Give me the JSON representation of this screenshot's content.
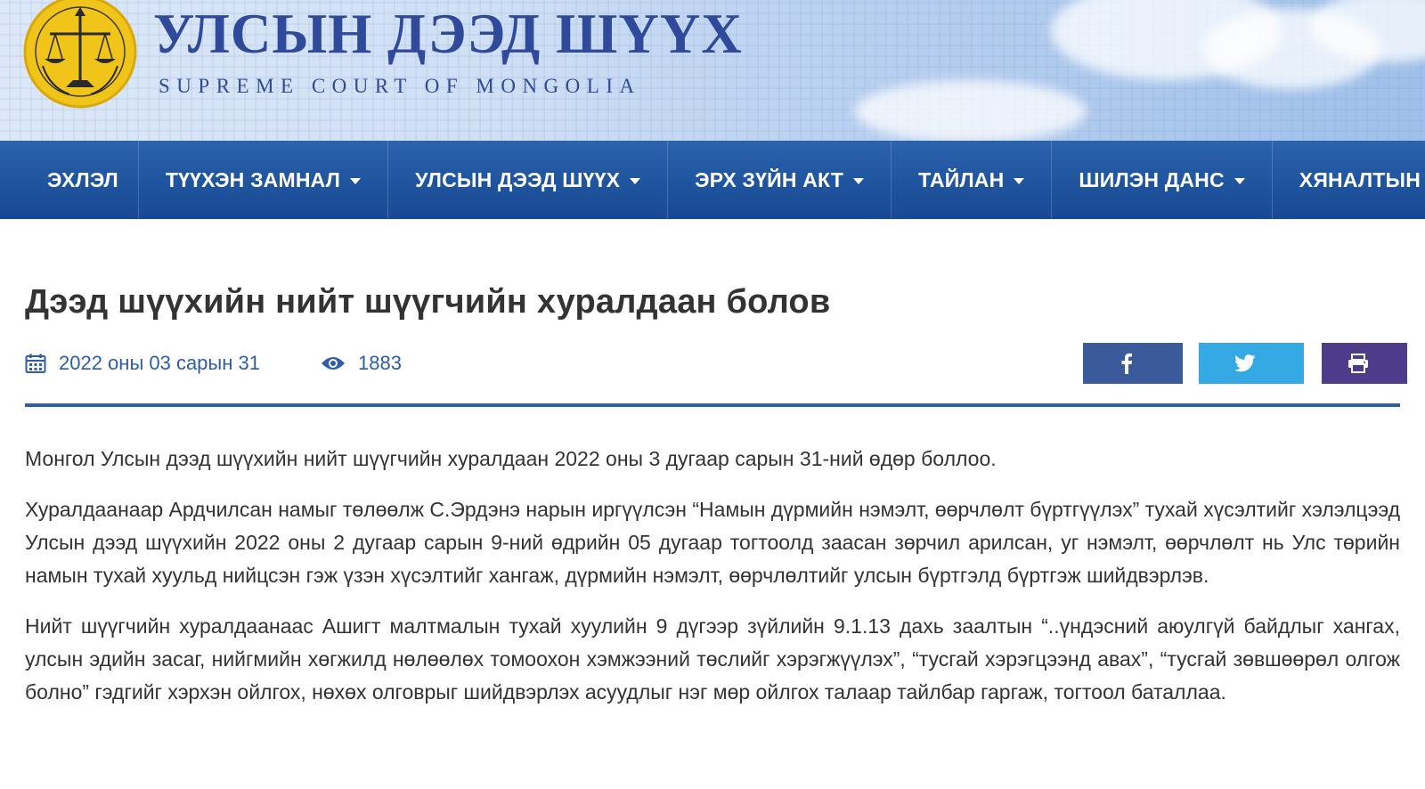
{
  "header": {
    "title": "УЛСЫН ДЭЭД ШҮҮХ",
    "subtitle": "SUPREME COURT OF MONGOLIA",
    "logo_icon": "scales-of-justice-emblem",
    "colors": {
      "title": "#2f4a9b",
      "emblem": "#f0c419"
    }
  },
  "nav": {
    "items": [
      {
        "label": "ЭХЛЭЛ",
        "dropdown": false
      },
      {
        "label": "ТҮҮХЭН ЗАМНАЛ",
        "dropdown": true
      },
      {
        "label": "УЛСЫН ДЭЭД ШҮҮХ",
        "dropdown": true
      },
      {
        "label": "ЭРХ ЗҮЙН АКТ",
        "dropdown": true
      },
      {
        "label": "ТАЙЛАН",
        "dropdown": true
      },
      {
        "label": "ШИЛЭН ДАНС",
        "dropdown": true
      },
      {
        "label": "ХЯНАЛТЫН ШАТНЫ ШҮ",
        "dropdown": false
      }
    ],
    "background": "#1f549e"
  },
  "article": {
    "title": "Дээд шүүхийн нийт шүүгчийн хуралдаан болов",
    "date": "2022 оны 03 сарын 31",
    "views": "1883",
    "meta_icons": [
      "calendar-icon",
      "eye-icon"
    ],
    "share_buttons": [
      {
        "name": "facebook",
        "icon": "facebook-icon",
        "color": "#3b5a9a"
      },
      {
        "name": "twitter",
        "icon": "twitter-icon",
        "color": "#35a9e3"
      },
      {
        "name": "print",
        "icon": "print-icon",
        "color": "#4e3b8a"
      }
    ],
    "accent": "#2d5ea8",
    "paragraphs": [
      "Монгол Улсын дээд шүүхийн нийт шүүгчийн хуралдаан 2022 оны 3 дугаар сарын 31-ний өдөр боллоо.",
      "Хуралдаанаар Ардчилсан намыг төлөөлж С.Эрдэнэ нарын иргүүлсэн “Намын дүрмийн нэмэлт, өөрчлөлт бүртгүүлэх” тухай хүсэлтийг хэлэлцээд Улсын дээд шүүхийн 2022 оны 2 дугаар сарын 9-ний өдрийн 05 дугаар тогтоолд заасан зөрчил арилсан, уг нэмэлт, өөрчлөлт нь Улс төрийн намын тухай хуульд нийцсэн гэж үзэн хүсэлтийг хангаж, дүрмийн нэмэлт, өөрчлөлтийг улсын бүртгэлд бүртгэж шийдвэрлэв.",
      "Нийт шүүгчийн хуралдаанаас Ашигт малтмалын тухай хуулийн 9 дүгээр зүйлийн 9.1.13 дахь заалтын “..үндэсний аюулгүй байдлыг хангах, улсын эдийн засаг, нийгмийн хөгжилд нөлөөлөх томоохон хэмжээний төслийг хэрэгжүүлэх”, “тусгай хэрэгцээнд авах”, “тусгай зөвшөөрөл олгож болно” гэдгийг хэрхэн ойлгох, нөхөх олговрыг шийдвэрлэх асуудлыг нэг мөр ойлгох талаар тайлбар гаргаж, тогтоол баталлаа."
    ]
  }
}
